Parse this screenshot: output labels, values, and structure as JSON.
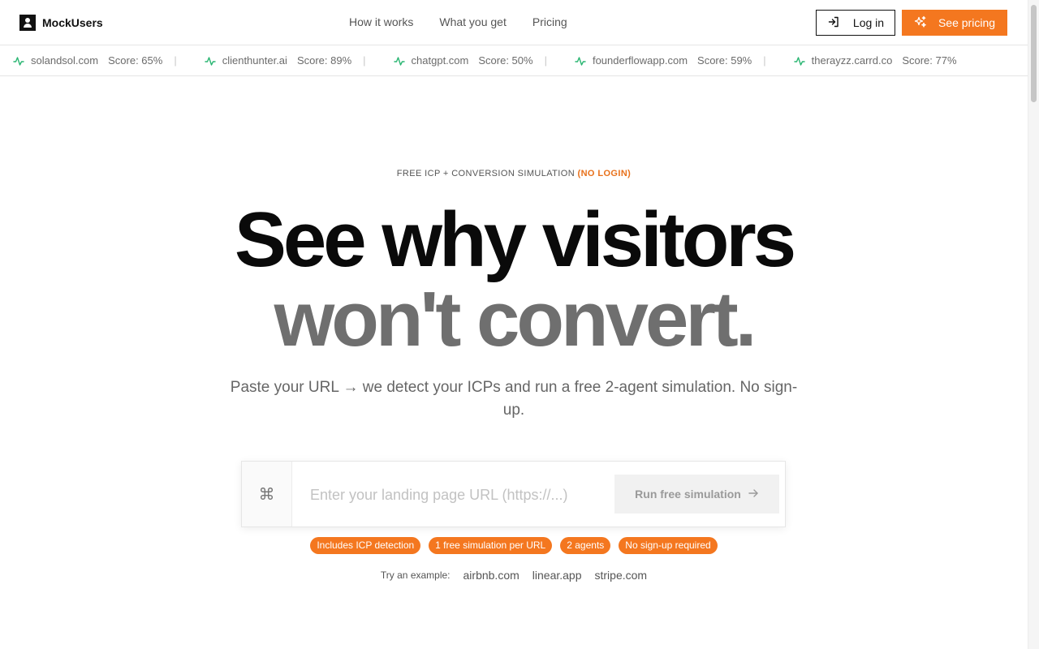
{
  "brand": {
    "name": "MockUsers"
  },
  "nav": {
    "items": [
      "How it works",
      "What you get",
      "Pricing"
    ]
  },
  "header": {
    "login_label": "Log in",
    "pricing_label": "See pricing"
  },
  "ticker": {
    "items": [
      {
        "domain": "solandsol.com",
        "score": "Score: 65%"
      },
      {
        "domain": "clienthunter.ai",
        "score": "Score: 89%"
      },
      {
        "domain": "chatgpt.com",
        "score": "Score: 50%"
      },
      {
        "domain": "founderflowapp.com",
        "score": "Score: 59%"
      },
      {
        "domain": "therayzz.carrd.co",
        "score": "Score: 77%"
      }
    ],
    "separator": "|"
  },
  "hero": {
    "eyebrow": "FREE ICP + CONVERSION SIMULATION",
    "eyebrow_accent": "(NO LOGIN)",
    "headline_line1": "See why visitors",
    "headline_line2": "won't convert.",
    "subtitle": "Paste your URL → we detect your ICPs and run a free 2-agent simulation. No sign-up."
  },
  "url_form": {
    "command_glyph": "⌘",
    "placeholder": "Enter your landing page URL (https://...)",
    "value": "",
    "button_label": "Run free simulation"
  },
  "pills": [
    "Includes ICP detection",
    "1 free simulation per URL",
    "2 agents",
    "No sign-up required"
  ],
  "examples": {
    "label": "Try an example:",
    "items": [
      "airbnb.com",
      "linear.app",
      "stripe.com"
    ]
  },
  "colors": {
    "accent": "#f4771f",
    "pulse": "#2bb673"
  }
}
